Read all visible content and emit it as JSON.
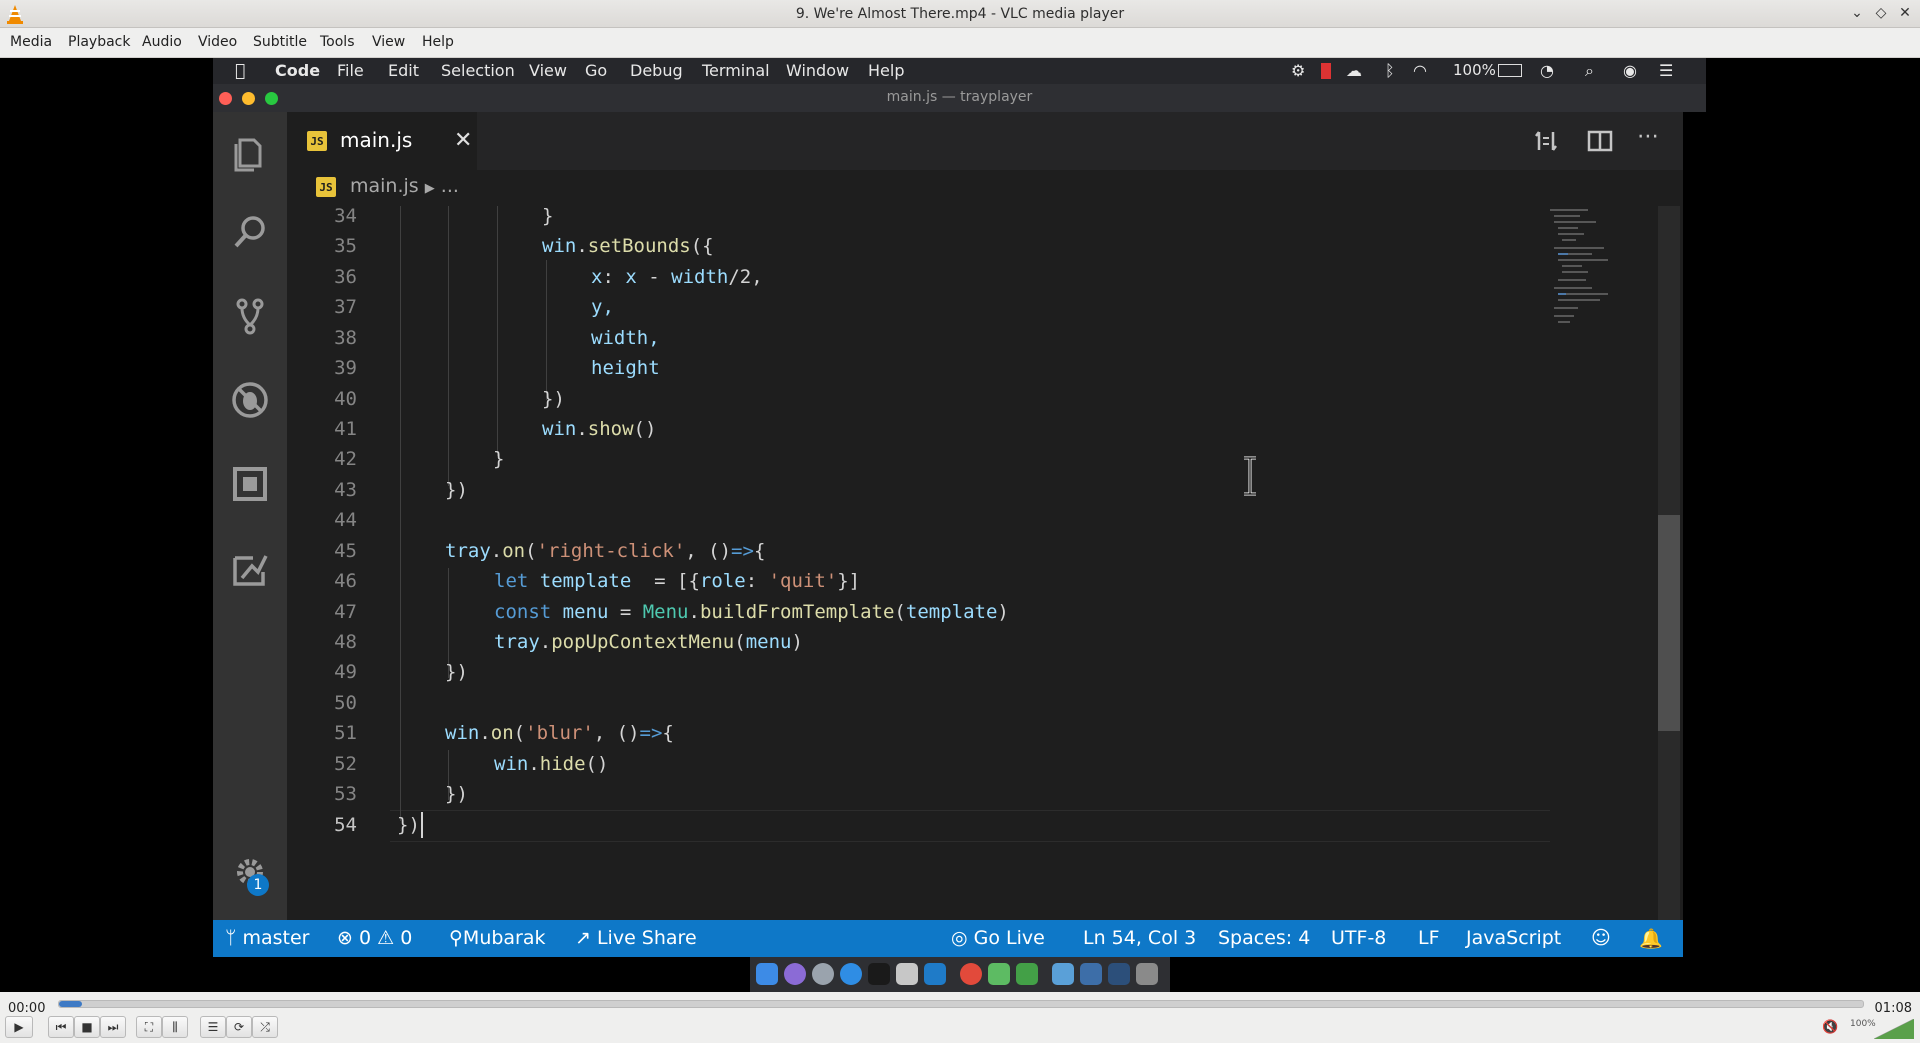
{
  "vlc": {
    "title": "9. We're Almost There.mp4 - VLC media player",
    "menu": [
      "Media",
      "Playback",
      "Audio",
      "Video",
      "Subtitle",
      "Tools",
      "View",
      "Help"
    ],
    "time_current": "00:00",
    "time_total": "01:08",
    "progress_fraction": 0.013,
    "volume_label": "100%",
    "volume_fraction": 1.0
  },
  "mac_menu": {
    "items": [
      "Code",
      "File",
      "Edit",
      "Selection",
      "View",
      "Go",
      "Debug",
      "Terminal",
      "Window",
      "Help"
    ],
    "battery": "100%"
  },
  "vscode": {
    "window_title": "main.js — trayplayer",
    "tab_label": "main.js",
    "tab_icon_text": "JS",
    "breadcrumb_file": "main.js",
    "breadcrumb_rest": "...",
    "settings_badge": "1"
  },
  "code_lines": [
    {
      "n": "34"
    },
    {
      "n": "35"
    },
    {
      "n": "36"
    },
    {
      "n": "37"
    },
    {
      "n": "38"
    },
    {
      "n": "39"
    },
    {
      "n": "40"
    },
    {
      "n": "41"
    },
    {
      "n": "42"
    },
    {
      "n": "43"
    },
    {
      "n": "44"
    },
    {
      "n": "45"
    },
    {
      "n": "46"
    },
    {
      "n": "47"
    },
    {
      "n": "48"
    },
    {
      "n": "49"
    },
    {
      "n": "50"
    },
    {
      "n": "51"
    },
    {
      "n": "52"
    },
    {
      "n": "53"
    },
    {
      "n": "54"
    }
  ],
  "code_text": {
    "l34": "}",
    "l35a": "win",
    "l35b": ".",
    "l35c": "setBounds",
    "l35d": "({",
    "l36a": "x",
    "l36b": ": ",
    "l36c": "x",
    "l36d": " - ",
    "l36e": "width",
    "l36f": "/2,",
    "l37": "y,",
    "l38": "width,",
    "l39": "height",
    "l40": "})",
    "l41a": "win",
    "l41b": ".",
    "l41c": "show",
    "l41d": "()",
    "l42": "}",
    "l43": "})",
    "l45a": "tray",
    "l45b": ".",
    "l45c": "on",
    "l45d": "(",
    "l45e": "'right-click'",
    "l45f": ", ()",
    "l45g": "=>",
    "l45h": "{",
    "l46a": "let",
    "l46b": " template",
    "l46c": "  = [{",
    "l46d": "role",
    "l46e": ": ",
    "l46f": "'quit'",
    "l46g": "}]",
    "l47a": "const",
    "l47b": " menu",
    "l47c": " = ",
    "l47d": "Menu",
    "l47e": ".",
    "l47f": "buildFromTemplate",
    "l47g": "(",
    "l47h": "template",
    "l47i": ")",
    "l48a": "tray",
    "l48b": ".",
    "l48c": "popUpContextMenu",
    "l48d": "(",
    "l48e": "menu",
    "l48f": ")",
    "l49": "})",
    "l51a": "win",
    "l51b": ".",
    "l51c": "on",
    "l51d": "(",
    "l51e": "'blur'",
    "l51f": ", ()",
    "l51g": "=>",
    "l51h": "{",
    "l52a": "win",
    "l52b": ".",
    "l52c": "hide",
    "l52d": "()",
    "l53": "})",
    "l54": "})"
  },
  "statusbar": {
    "branch": "master",
    "errors": "0",
    "warnings": "0",
    "user": "Mubarak",
    "live_share": "Live Share",
    "go_live": "Go Live",
    "position": "Ln 54, Col 3",
    "spaces": "Spaces: 4",
    "encoding": "UTF-8",
    "eol": "LF",
    "language": "JavaScript"
  },
  "colors": {
    "statusbar": "#0e78c8",
    "editor_bg": "#1e1e1e",
    "activity_bg": "#333333",
    "seek_fill": "#3e7ac5"
  }
}
